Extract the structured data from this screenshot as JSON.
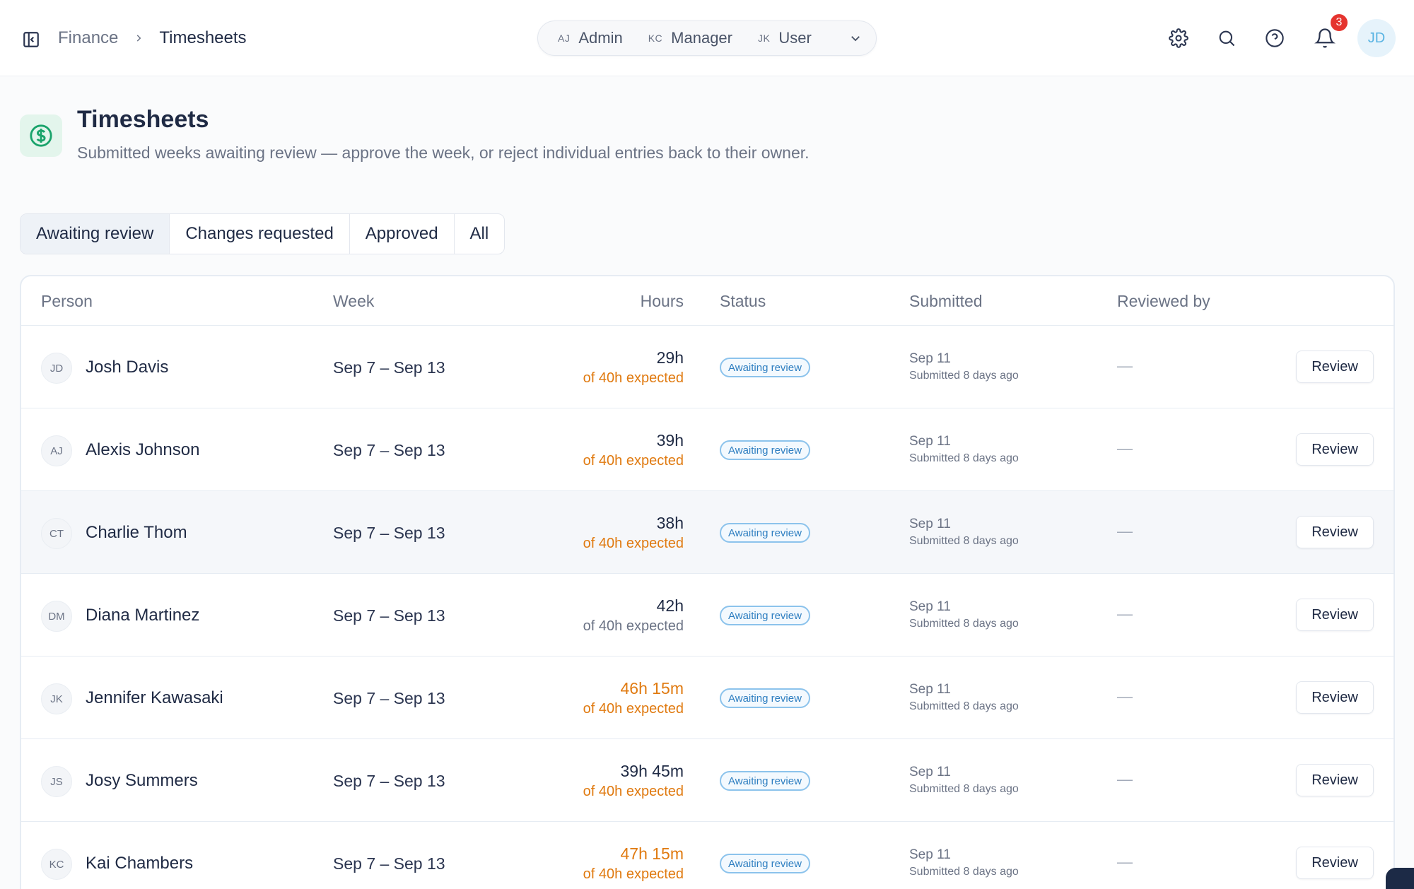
{
  "breadcrumb": {
    "parent": "Finance",
    "current": "Timesheets"
  },
  "roles": [
    {
      "initials": "AJ",
      "label": "Admin"
    },
    {
      "initials": "KC",
      "label": "Manager"
    },
    {
      "initials": "JK",
      "label": "User"
    }
  ],
  "notifications": {
    "count": "3"
  },
  "user": {
    "initials": "JD"
  },
  "page": {
    "title": "Timesheets",
    "subtitle": "Submitted weeks awaiting review — approve the week, or reject individual entries back to their owner."
  },
  "tabs": [
    {
      "label": "Awaiting review",
      "active": true
    },
    {
      "label": "Changes requested",
      "active": false
    },
    {
      "label": "Approved",
      "active": false
    },
    {
      "label": "All",
      "active": false
    }
  ],
  "table": {
    "headers": {
      "person": "Person",
      "week": "Week",
      "hours": "Hours",
      "status": "Status",
      "submitted": "Submitted",
      "reviewed_by": "Reviewed by"
    },
    "rows": [
      {
        "initials": "JD",
        "name": "Josh Davis",
        "week": "Sep 7 – Sep 13",
        "hours": "29h",
        "hours_flag": "under",
        "expected": "of 40h expected",
        "status": "Awaiting review",
        "submitted_date": "Sep 11",
        "submitted_ago": "Submitted 8 days ago",
        "reviewed_by": "—",
        "action": "Review"
      },
      {
        "initials": "AJ",
        "name": "Alexis Johnson",
        "week": "Sep 7 – Sep 13",
        "hours": "39h",
        "hours_flag": "under",
        "expected": "of 40h expected",
        "status": "Awaiting review",
        "submitted_date": "Sep 11",
        "submitted_ago": "Submitted 8 days ago",
        "reviewed_by": "—",
        "action": "Review"
      },
      {
        "initials": "CT",
        "name": "Charlie Thom",
        "week": "Sep 7 – Sep 13",
        "hours": "38h",
        "hours_flag": "under",
        "expected": "of 40h expected",
        "status": "Awaiting review",
        "submitted_date": "Sep 11",
        "submitted_ago": "Submitted 8 days ago",
        "reviewed_by": "—",
        "action": "Review"
      },
      {
        "initials": "DM",
        "name": "Diana Martinez",
        "week": "Sep 7 – Sep 13",
        "hours": "42h",
        "hours_flag": "ok",
        "expected": "of 40h expected",
        "status": "Awaiting review",
        "submitted_date": "Sep 11",
        "submitted_ago": "Submitted 8 days ago",
        "reviewed_by": "—",
        "action": "Review"
      },
      {
        "initials": "JK",
        "name": "Jennifer Kawasaki",
        "week": "Sep 7 – Sep 13",
        "hours": "46h 15m",
        "hours_flag": "over",
        "expected": "of 40h expected",
        "status": "Awaiting review",
        "submitted_date": "Sep 11",
        "submitted_ago": "Submitted 8 days ago",
        "reviewed_by": "—",
        "action": "Review"
      },
      {
        "initials": "JS",
        "name": "Josy Summers",
        "week": "Sep 7 – Sep 13",
        "hours": "39h 45m",
        "hours_flag": "under",
        "expected": "of 40h expected",
        "status": "Awaiting review",
        "submitted_date": "Sep 11",
        "submitted_ago": "Submitted 8 days ago",
        "reviewed_by": "—",
        "action": "Review"
      },
      {
        "initials": "KC",
        "name": "Kai Chambers",
        "week": "Sep 7 – Sep 13",
        "hours": "47h 15m",
        "hours_flag": "over",
        "expected": "of 40h expected",
        "status": "Awaiting review",
        "submitted_date": "Sep 11",
        "submitted_ago": "Submitted 8 days ago",
        "reviewed_by": "—",
        "action": "Review"
      }
    ]
  },
  "colors": {
    "accent_green": "#1aa36b",
    "warning_orange": "#e07a10",
    "status_blue": "#2f7fc1",
    "badge_red": "#e5342f"
  },
  "icons": {
    "sidebar_toggle": "sidebar-toggle-icon",
    "settings": "gear-icon",
    "search": "search-icon",
    "help": "help-circle-icon",
    "notifications": "bell-icon",
    "page": "dollar-circle-icon"
  }
}
